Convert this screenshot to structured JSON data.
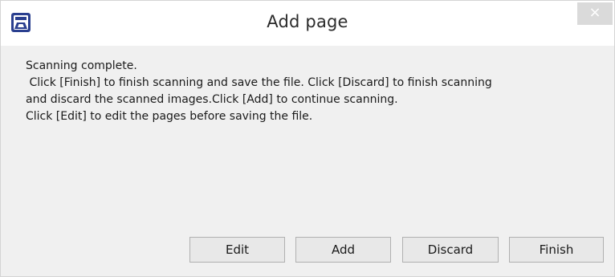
{
  "window": {
    "title": "Add page",
    "close_glyph": "×",
    "app_icon": "scanner-app-icon",
    "accent_color": "#2a3f8f"
  },
  "message": {
    "lines": [
      "Scanning complete.",
      " Click [Finish] to finish scanning and save the file. Click [Discard] to finish scanning",
      "and discard the scanned images.Click [Add] to continue scanning.",
      "Click [Edit] to edit the pages before saving the file."
    ]
  },
  "buttons": {
    "edit": "Edit",
    "add": "Add",
    "discard": "Discard",
    "finish": "Finish"
  }
}
